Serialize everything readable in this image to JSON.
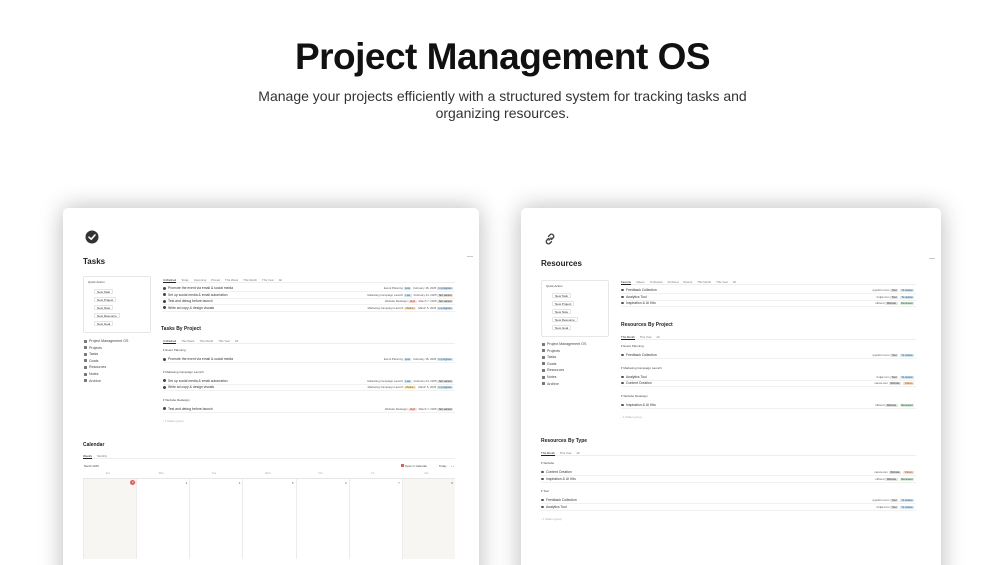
{
  "hero": {
    "title": "Project Management OS",
    "subtitle": "Manage your projects efficiently with a structured system for tracking tasks and organizing resources."
  },
  "icons": {
    "tasks": "check-circle-icon",
    "resources": "link-icon"
  },
  "quick_action": {
    "label": "Quick Action",
    "items": [
      "New Task",
      "New Project",
      "New Note",
      "New Resource",
      "New Goal"
    ]
  },
  "nav": [
    "Project Management OS",
    "Projects",
    "Tasks",
    "Goals",
    "Resources",
    "Notes",
    "Archive"
  ],
  "tasks_page": {
    "title": "Tasks",
    "tabs": [
      "Unfinished",
      "Today",
      "Upcoming",
      "Pinned",
      "This Week",
      "This Month",
      "This Year",
      "All"
    ],
    "rows": [
      {
        "name": "Promote the event via email & social media",
        "project": "Event Planning",
        "priority": "Low",
        "date": "February 18, 2025",
        "status": "In progress"
      },
      {
        "name": "Set up social media & email automation",
        "project": "Marketing Campaign Launch",
        "priority": "Low",
        "date": "February 24, 2025",
        "status": "Not started"
      },
      {
        "name": "Test and debug before launch",
        "project": "Website Redesign",
        "priority": "High",
        "date": "March 7, 2025",
        "status": "Not started"
      },
      {
        "name": "Write ad copy & design visuals",
        "project": "Marketing Campaign Launch",
        "priority": "Medium",
        "date": "March 5, 2025",
        "status": "In progress"
      }
    ],
    "by_project": {
      "title": "Tasks By Project",
      "tabs": [
        "Unfinished",
        "This Week",
        "This Month",
        "This Year",
        "All"
      ],
      "groups": [
        {
          "name": "Event Planning",
          "rows": [
            {
              "name": "Promote the event via email & social media",
              "project": "Event Planning",
              "priority": "Low",
              "date": "February 18, 2025",
              "status": "In progress"
            }
          ]
        },
        {
          "name": "Marketing Campaign Launch",
          "rows": [
            {
              "name": "Set up social media & email automation",
              "project": "Marketing Campaign Launch",
              "priority": "Low",
              "date": "February 24, 2025",
              "status": "Not started"
            },
            {
              "name": "Write ad copy & design visuals",
              "project": "Marketing Campaign Launch",
              "priority": "Medium",
              "date": "March 5, 2025",
              "status": "In progress"
            }
          ]
        },
        {
          "name": "Website Redesign",
          "rows": [
            {
              "name": "Test and debug before launch",
              "project": "Website Redesign",
              "priority": "High",
              "date": "March 7, 2025",
              "status": "Not started"
            }
          ]
        }
      ],
      "hidden_groups": "1 hidden group"
    },
    "calendar": {
      "title": "Calendar",
      "tabs": [
        "Weekly",
        "Monthly"
      ],
      "month": "March 2025",
      "open_in": "Open in Calendar",
      "today": "Today",
      "weekdays": [
        "Sun",
        "Mon",
        "Tue",
        "Wed",
        "Thu",
        "Fri",
        "Sat"
      ],
      "days": [
        "2",
        "3",
        "4",
        "5",
        "6",
        "7",
        "8"
      ],
      "today_day": "2"
    }
  },
  "resources_page": {
    "title": "Resources",
    "tabs": [
      "Favorite",
      "Videos",
      "To Review",
      "Archived",
      "Recent",
      "This Month",
      "This Year",
      "All"
    ],
    "rows": [
      {
        "name": "Feedback Collection",
        "source": "typeform.com",
        "type": "Tool",
        "status": "To review"
      },
      {
        "name": "Analytics Tool",
        "source": "hotjar.com",
        "type": "Tool",
        "status": "To review"
      },
      {
        "name": "Inspiration & UI Kits",
        "source": "uiflow.it",
        "type": "Website",
        "status": "Reviewed"
      }
    ],
    "by_project": {
      "title": "Resources By Project",
      "tabs": [
        "This Month",
        "This Year",
        "All"
      ],
      "groups": [
        {
          "name": "Event Planning",
          "rows": [
            {
              "name": "Feedback Collection",
              "source": "typeform.com",
              "type": "Tool",
              "status": "To review"
            }
          ]
        },
        {
          "name": "Marketing Campaign Launch",
          "rows": [
            {
              "name": "Analytics Tool",
              "source": "hotjar.com",
              "type": "Tool",
              "status": "To review"
            },
            {
              "name": "Content Creation",
              "source": "canva.com",
              "type": "Website",
              "status": "Videos"
            }
          ]
        },
        {
          "name": "Website Redesign",
          "rows": [
            {
              "name": "Inspiration & UI Kits",
              "source": "uiflow.it",
              "type": "Website",
              "status": "Reviewed"
            }
          ]
        }
      ],
      "hidden_groups": "1 hidden group"
    },
    "by_type": {
      "title": "Resources By Type",
      "tabs": [
        "This Month",
        "This Year",
        "All"
      ],
      "groups": [
        {
          "name": "Website",
          "rows": [
            {
              "name": "Content Creation",
              "source": "canva.com",
              "type": "Website",
              "status": "Videos"
            },
            {
              "name": "Inspiration & UI Kits",
              "source": "uiflow.it",
              "type": "Website",
              "status": "Reviewed"
            }
          ]
        },
        {
          "name": "Tool",
          "rows": [
            {
              "name": "Feedback Collection",
              "source": "typeform.com",
              "type": "Tool",
              "status": "To review"
            },
            {
              "name": "Analytics Tool",
              "source": "hotjar.com",
              "type": "Tool",
              "status": "To review"
            }
          ]
        }
      ],
      "hidden_groups": "1 hidden group"
    }
  },
  "colors": {
    "accent_red": "#eb5757",
    "text": "#37352f",
    "weekend_bg": "#f7f6f3"
  }
}
